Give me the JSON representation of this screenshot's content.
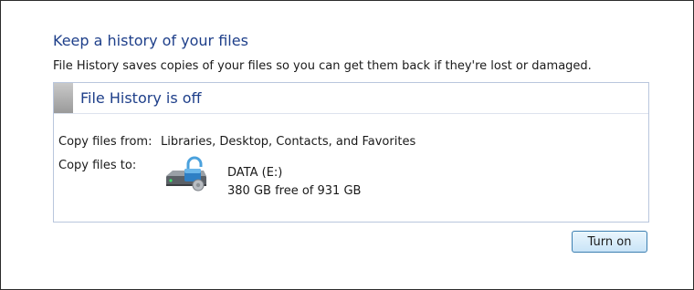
{
  "page": {
    "heading": "Keep a history of your files",
    "description": "File History saves copies of your files so you can get them back if they're lost or damaged."
  },
  "status_panel": {
    "title": "File History is off",
    "copy_from_label": "Copy files from:",
    "copy_from_value": "Libraries, Desktop, Contacts, and Favorites",
    "copy_to_label": "Copy files to:",
    "drive": {
      "icon": "locked-hard-drive-icon",
      "name": "DATA (E:)",
      "free_space": "380 GB free of 931 GB"
    }
  },
  "actions": {
    "turn_on_label": "Turn on"
  },
  "colors": {
    "heading": "#1e3f8a",
    "panel_border": "#b9c6dd",
    "button_border": "#3c7fb1"
  }
}
